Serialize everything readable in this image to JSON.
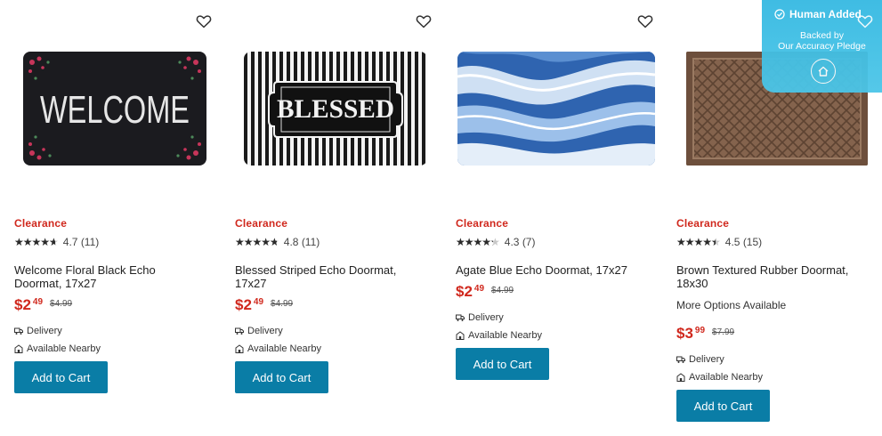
{
  "colors": {
    "accent": "#0a7da6",
    "clearance": "#d0281d",
    "badge": "#35b9e2"
  },
  "products": [
    {
      "image_text": "WELCOME",
      "badge": "Clearance",
      "rating_value": 4.7,
      "rating": "4.7 (11)",
      "title": "Welcome Floral Black Echo Doormat, 17x27",
      "price_dollars": "$2",
      "price_cents": "49",
      "was_price": "$4.99",
      "more_options": "",
      "delivery": "Delivery",
      "nearby": "Available Nearby",
      "cta": "Add to Cart"
    },
    {
      "image_text": "BLESSED",
      "badge": "Clearance",
      "rating_value": 4.8,
      "rating": "4.8 (11)",
      "title": "Blessed Striped Echo Doormat, 17x27",
      "price_dollars": "$2",
      "price_cents": "49",
      "was_price": "$4.99",
      "more_options": "",
      "delivery": "Delivery",
      "nearby": "Available Nearby",
      "cta": "Add to Cart"
    },
    {
      "image_text": "",
      "badge": "Clearance",
      "rating_value": 4.3,
      "rating": "4.3 (7)",
      "title": "Agate Blue Echo Doormat, 17x27",
      "price_dollars": "$2",
      "price_cents": "49",
      "was_price": "$4.99",
      "more_options": "",
      "delivery": "Delivery",
      "nearby": "Available Nearby",
      "cta": "Add to Cart"
    },
    {
      "image_text": "",
      "badge": "Clearance",
      "rating_value": 4.5,
      "rating": "4.5 (15)",
      "title": "Brown Textured Rubber Doormat, 18x30",
      "price_dollars": "$3",
      "price_cents": "99",
      "was_price": "$7.99",
      "more_options": "More Options Available",
      "delivery": "Delivery",
      "nearby": "Available Nearby",
      "cta": "Add to Cart"
    }
  ],
  "pledge_badge": {
    "heading": "Human Added",
    "line1": "Backed by",
    "line2": "Our Accuracy Pledge",
    "icon": "home-icon"
  },
  "icons": {
    "favorite": "heart-icon",
    "delivery": "truck-icon",
    "nearby": "store-icon",
    "check": "check-circle-icon"
  }
}
